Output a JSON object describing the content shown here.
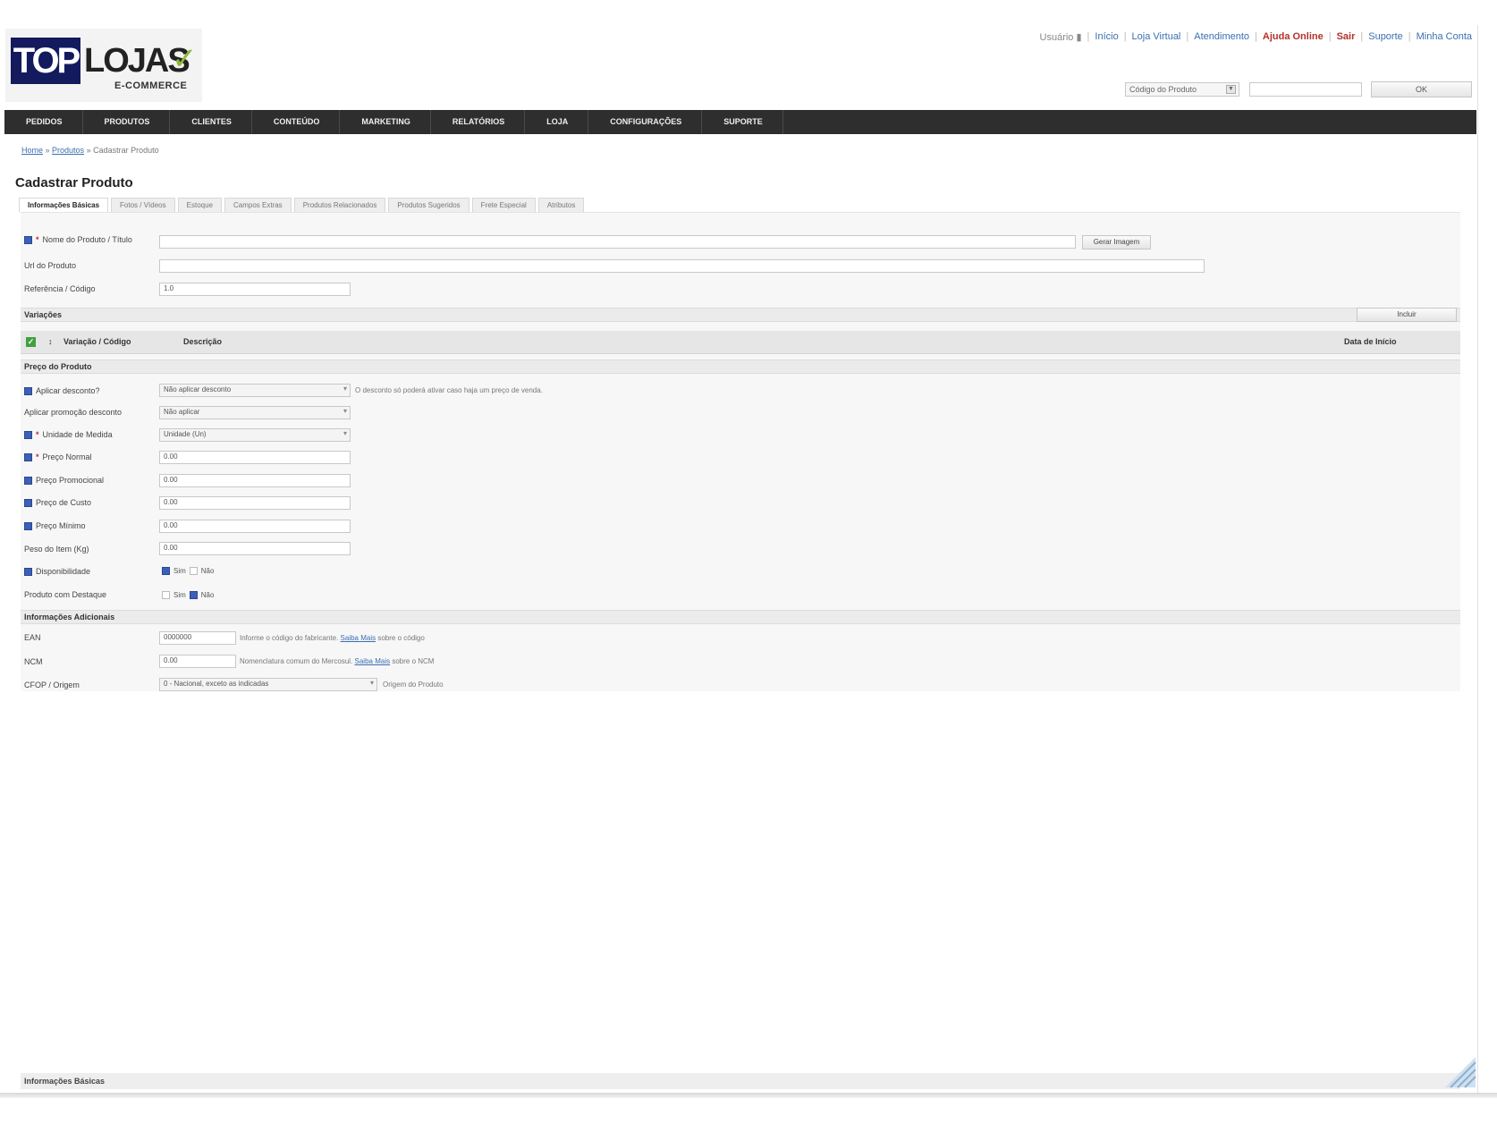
{
  "brand": {
    "logo_main": "TOP",
    "logo_second": "LOJAS",
    "logo_sub": "E-COMMERCE"
  },
  "toplinks": {
    "user": "Usuário ▮",
    "links": [
      {
        "label": "Início",
        "style": "normal"
      },
      {
        "label": "Loja Virtual",
        "style": "normal"
      },
      {
        "label": "Atendimento",
        "style": "normal"
      },
      {
        "label": "Ajuda Online",
        "style": "red"
      },
      {
        "label": "Sair",
        "style": "red"
      },
      {
        "label": "Suporte",
        "style": "normal"
      },
      {
        "label": "Minha Conta",
        "style": "normal"
      }
    ]
  },
  "search": {
    "select_value": "Código do Produto",
    "button_label": "OK"
  },
  "nav": [
    "PEDIDOS",
    "PRODUTOS",
    "CLIENTES",
    "CONTEÚDO",
    "MARKETING",
    "RELATÓRIOS",
    "LOJA",
    "CONFIGURAÇÕES",
    "SUPORTE"
  ],
  "breadcrumb": {
    "home": "Home",
    "catalog": "Produtos",
    "current": "Cadastrar Produto"
  },
  "page_title": "Cadastrar Produto",
  "tabs": [
    "Informações Básicas",
    "Fotos / Vídeos",
    "Estoque",
    "Campos Extras",
    "Produtos Relacionados",
    "Produtos Sugeridos",
    "Frete Especial",
    "Atributos"
  ],
  "form": {
    "name_label": "Nome do Produto / Título",
    "name_button": "Gerar Imagem",
    "url_label": "Url do Produto",
    "ref_label": "Referência / Código",
    "ref_value": "1.0",
    "variations_title": "Variações",
    "variations_button": "Incluir",
    "grid_headers": {
      "cod": "Variação / Código",
      "desc": "Descrição",
      "date": "Data de Início"
    },
    "prices_title": "Preço do Produto",
    "discount_label": "Aplicar desconto?",
    "discount_value": "Não aplicar desconto",
    "discount_hint": "O desconto só poderá ativar caso haja um preço de venda.",
    "promo_label": "Aplicar promoção desconto",
    "promo_value": "Não aplicar",
    "unit_label": "Unidade de Medida",
    "unit_value": "Unidade (Un)",
    "price_label": "Preço Normal",
    "price_value": "0.00",
    "promo_price_label": "Preço Promocional",
    "promo_price_value": "0.00",
    "cost_label": "Preço de Custo",
    "cost_value": "0.00",
    "min_price_label": "Preço Mínimo",
    "min_price_value": "0.00",
    "weight_label": "Peso do Item (Kg)",
    "weight_value": "0.00",
    "available_label": "Disponibilidade",
    "available_yes": "Sim",
    "available_no": "Não",
    "featured_label": "Produto com Destaque",
    "featured_yes": "Sim",
    "featured_no": "Não",
    "more_title": "Informações Adicionais",
    "ean_label": "EAN",
    "ean_value": "0000000",
    "ean_hint": "Informe o código do fabricante.",
    "ean_link": "Saiba Mais",
    "ean_hint2": "sobre o código",
    "ncm_label": "NCM",
    "ncm_value": "0.00",
    "ncm_hint": "Nomenclatura comum do Mercosul.",
    "ncm_link": "Saiba Mais",
    "ncm_hint2": "sobre o NCM",
    "origin_label": "CFOP / Origem",
    "origin_value": "0 - Nacional, exceto as indicadas",
    "origin_hint": "Origem do Produto"
  },
  "status": {
    "text": "Informações Básicas"
  }
}
